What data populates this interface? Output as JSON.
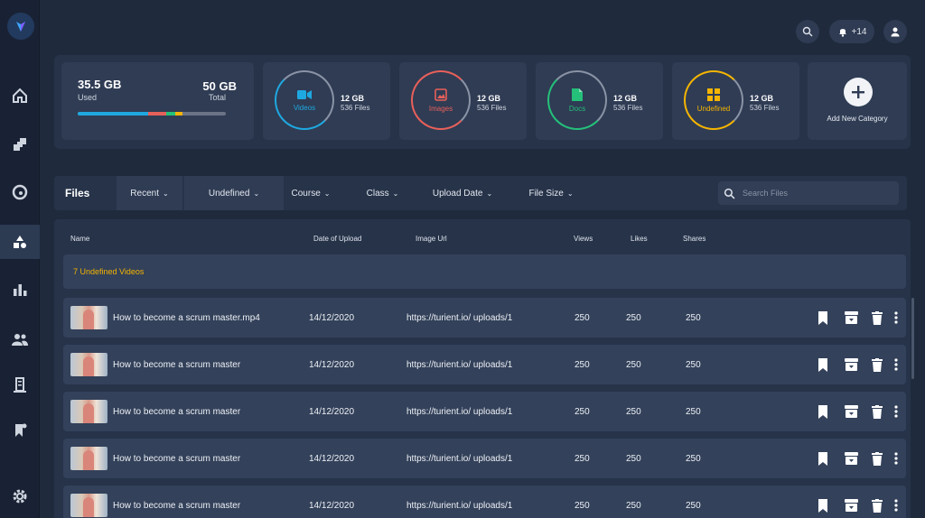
{
  "header": {
    "notifications_badge": "+14"
  },
  "storage": {
    "used_value": "35.5 GB",
    "used_label": "Used",
    "total_value": "50 GB",
    "total_label": "Total",
    "used_fraction": 0.71
  },
  "categories": [
    {
      "label": "Videos",
      "size": "12 GB",
      "files": "536 Files",
      "color": "#1fa8e0",
      "icon": "video-camera-icon"
    },
    {
      "label": "Images",
      "size": "12 GB",
      "files": "536 Files",
      "color": "#e8605a",
      "icon": "image-icon"
    },
    {
      "label": "Docs",
      "size": "12 GB",
      "files": "536 Files",
      "color": "#25c07a",
      "icon": "document-icon"
    },
    {
      "label": "Undefined",
      "size": "12 GB",
      "files": "536 Files",
      "color": "#f5b400",
      "icon": "grid-icon"
    }
  ],
  "add_category_label": "Add New Category",
  "files_bar": {
    "title": "Files",
    "filters": [
      "Recent",
      "Undefined",
      "Course",
      "Class",
      "Upload Date",
      "File Size"
    ],
    "search_placeholder": "Search Files"
  },
  "table": {
    "columns": [
      "Name",
      "Date of  Upload",
      "Image Url",
      "Views",
      "Likes",
      "Shares"
    ],
    "group_label": "7 Undefined Videos",
    "rows": [
      {
        "name": "How to become a scrum master.mp4",
        "date": "14/12/2020",
        "url": "https://turient.io/ uploads/1",
        "views": "250",
        "likes": "250",
        "shares": "250"
      },
      {
        "name": "How to become a scrum master",
        "date": "14/12/2020",
        "url": "https://turient.io/ uploads/1",
        "views": "250",
        "likes": "250",
        "shares": "250"
      },
      {
        "name": "How to become a scrum master",
        "date": "14/12/2020",
        "url": "https://turient.io/ uploads/1",
        "views": "250",
        "likes": "250",
        "shares": "250"
      },
      {
        "name": "How to become a scrum master",
        "date": "14/12/2020",
        "url": "https://turient.io/ uploads/1",
        "views": "250",
        "likes": "250",
        "shares": "250"
      },
      {
        "name": "How to become a scrum master",
        "date": "14/12/2020",
        "url": "https://turient.io/ uploads/1",
        "views": "250",
        "likes": "250",
        "shares": "250"
      }
    ]
  },
  "sidebar": {
    "items": [
      "home-icon",
      "puzzle-icon",
      "palette-icon",
      "shapes-icon",
      "bar-chart-icon",
      "users-icon",
      "building-icon",
      "bookmark-icon",
      "settings-icon"
    ],
    "active_index": 3
  }
}
